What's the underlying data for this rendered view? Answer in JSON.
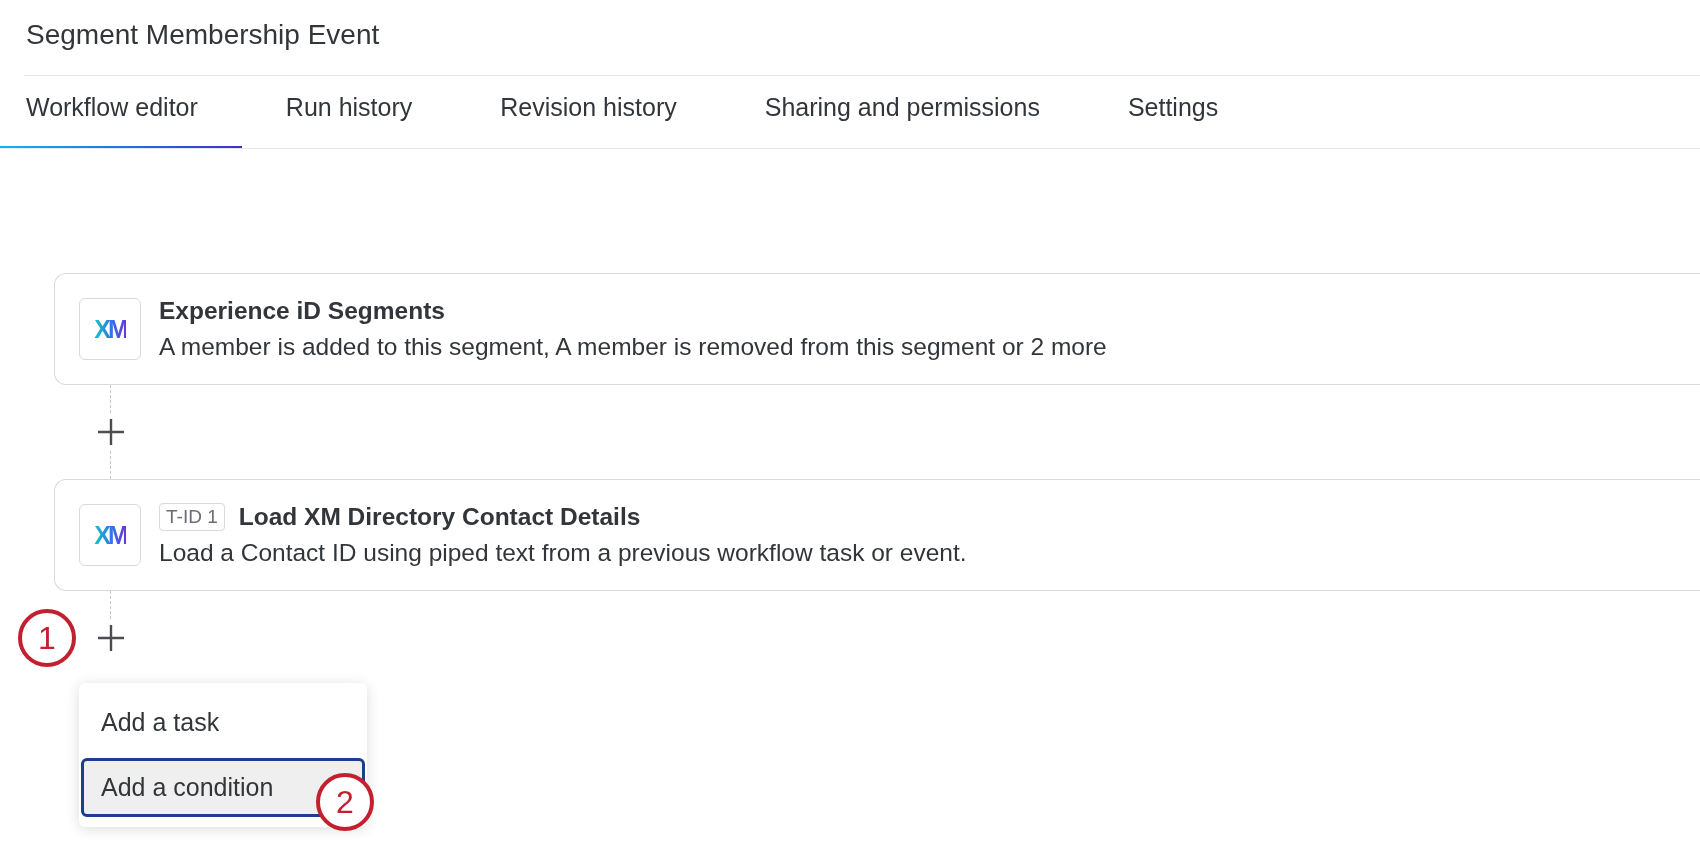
{
  "page_title": "Segment Membership Event",
  "tabs": [
    {
      "label": "Workflow editor",
      "selected": true
    },
    {
      "label": "Run history",
      "selected": false
    },
    {
      "label": "Revision history",
      "selected": false
    },
    {
      "label": "Sharing and permissions",
      "selected": false
    },
    {
      "label": "Settings",
      "selected": false
    }
  ],
  "workflow_steps": [
    {
      "logo": "XM",
      "title": "Experience iD Segments",
      "description": "A member is added to this segment, A member is removed from this segment or 2 more"
    },
    {
      "logo": "XM",
      "badge": "T-ID 1",
      "title": "Load XM Directory Contact Details",
      "description": "Load a Contact ID using piped text from a previous workflow task or event."
    }
  ],
  "add_menu": {
    "items": [
      {
        "label": "Add a task",
        "selected": false
      },
      {
        "label": "Add a condition",
        "selected": true
      }
    ]
  },
  "callouts": [
    {
      "kind": "plus",
      "text": "1"
    },
    {
      "kind": "menu",
      "text": "2"
    }
  ]
}
